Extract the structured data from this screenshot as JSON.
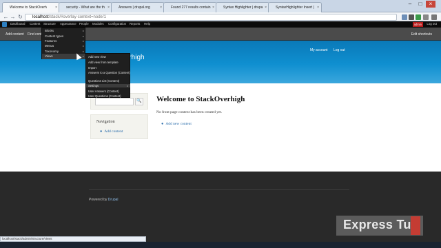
{
  "browser": {
    "tabs": [
      {
        "label": "Welcome to StackOverh"
      },
      {
        "label": "security - What are the th"
      },
      {
        "label": "Answers | drupal.org"
      },
      {
        "label": "Found 277 results contain"
      },
      {
        "label": "Syntax Highlighter | drupa"
      },
      {
        "label": "SyntaxHighlighter Insert |"
      }
    ],
    "url_host": "localhost",
    "url_path": "/stack/#overlay-context=node/1",
    "status_url": "localhost/stack/admin/structure/views"
  },
  "admin_toolbar": {
    "items": [
      "Dashboard",
      "Content",
      "Structure",
      "Appearance",
      "People",
      "Modules",
      "Configuration",
      "Reports",
      "Help"
    ],
    "user": "admin",
    "logout": "Log out"
  },
  "shortcuts": {
    "items": [
      "Add content",
      "Find content"
    ],
    "edit": "Edit shortcuts"
  },
  "structure_menu": [
    {
      "label": "Blocks"
    },
    {
      "label": "Content types"
    },
    {
      "label": "Features"
    },
    {
      "label": "Menus"
    },
    {
      "label": "Taxonomy"
    },
    {
      "label": "Views"
    }
  ],
  "views_submenu": [
    {
      "label": "Add new view"
    },
    {
      "label": "Add view from template"
    },
    {
      "label": "Import"
    },
    {
      "label": "Answers to a Question (Content)"
    },
    {
      "label": "Questions List (Content)"
    },
    {
      "label": "Settings"
    },
    {
      "label": "User Answers (Content)"
    },
    {
      "label": "User Questions (Content)"
    }
  ],
  "header": {
    "site_name": "StackOverhigh",
    "secondary_links": [
      "My account",
      "Log out"
    ]
  },
  "sidebar": {
    "search_button": "🔍",
    "navigation_title": "Navigation",
    "navigation_link": "Add content"
  },
  "main": {
    "title": "Welcome to StackOverhigh",
    "empty_text": "No front page content has been created yet.",
    "link": "Add new content"
  },
  "footer": {
    "powered_by": "Powered by",
    "drupal": "Drupal"
  },
  "watermark": {
    "text": "Express Tut"
  }
}
